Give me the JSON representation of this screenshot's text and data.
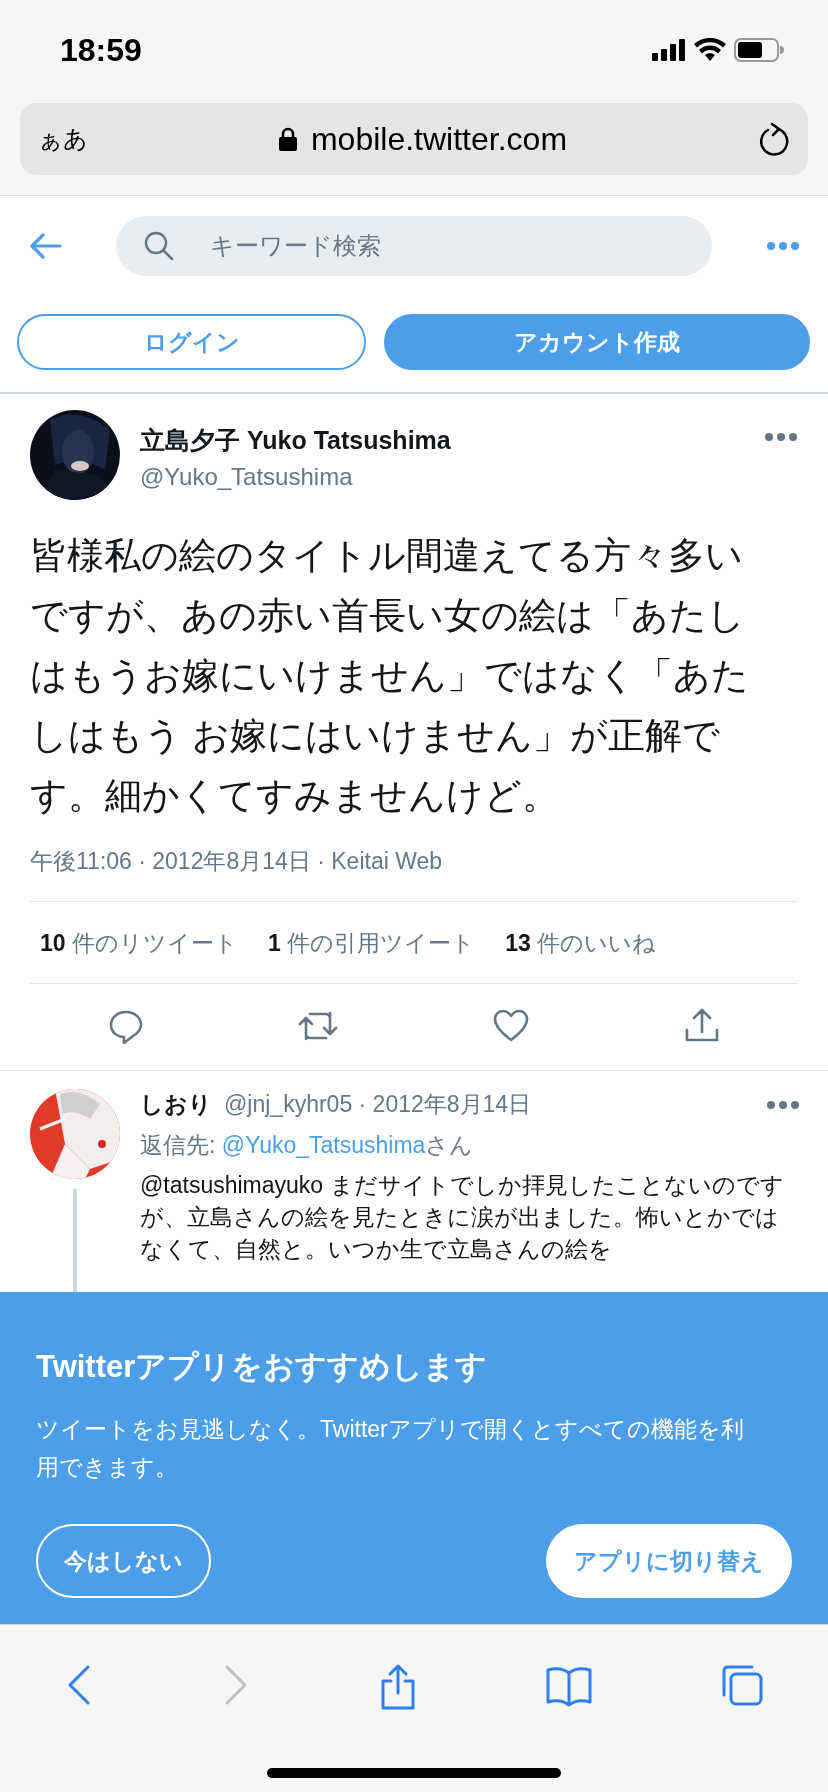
{
  "status_bar": {
    "time": "18:59"
  },
  "browser": {
    "text_size_button": "ぁあ",
    "url": "mobile.twitter.com"
  },
  "header": {
    "search": {
      "placeholder": "キーワード検索"
    }
  },
  "auth_buttons": [
    {
      "label": "ログイン",
      "kind": "outline"
    },
    {
      "label": "アカウント作成",
      "kind": "filled"
    }
  ],
  "tweet": {
    "name": "立島夕子 Yuko Tatsushima",
    "handle": "@Yuko_Tatsushima",
    "text": "皆様私の絵のタイトル間違えてる方々多いですが、あの赤い首長い女の絵は「あたしはもうお嫁にいけません」ではなく「あたしはもう お嫁にはいけません」が正解です。細かくてすみませんけど。",
    "meta": "午後11:06 · 2012年8月14日 · Keitai Web",
    "stats": [
      "**10** 件のリツイート",
      "**1** 件の引用ツイート",
      "**13** 件のいいね"
    ],
    "actions": [
      {
        "kind": "reply"
      },
      {
        "kind": "retweet"
      },
      {
        "kind": "like"
      },
      {
        "kind": "share"
      }
    ]
  },
  "reply": {
    "name": "しおり",
    "meta": "@jnj_kyhr05 · 2012年8月14日",
    "reply_to": {
      "prefix": "返信先: ",
      "handle": "@Yuko_Tatsushima",
      "suffix": "さん"
    },
    "text": "@tatsushimayuko まだサイトでしか拝見したことないのですが、立島さんの絵を見たときに涙が出ました。怖いとかではなくて、自然と。いつか生で立島さんの絵を"
  },
  "banner": {
    "title": "Twitterアプリをおすすめします",
    "text": "ツイートをお見逃しなく。Twitterアプリで開くとすべての機能を利用できます。",
    "buttons": [
      {
        "label": "今はしない",
        "kind": "outline"
      },
      {
        "label": "アプリに切り替え",
        "kind": "filled"
      }
    ]
  },
  "toolbar": [
    {
      "kind": "back",
      "disabled": false
    },
    {
      "kind": "forward",
      "disabled": true
    },
    {
      "kind": "share",
      "disabled": false
    },
    {
      "kind": "bookmarks",
      "disabled": false
    },
    {
      "kind": "tabs",
      "disabled": false
    }
  ]
}
